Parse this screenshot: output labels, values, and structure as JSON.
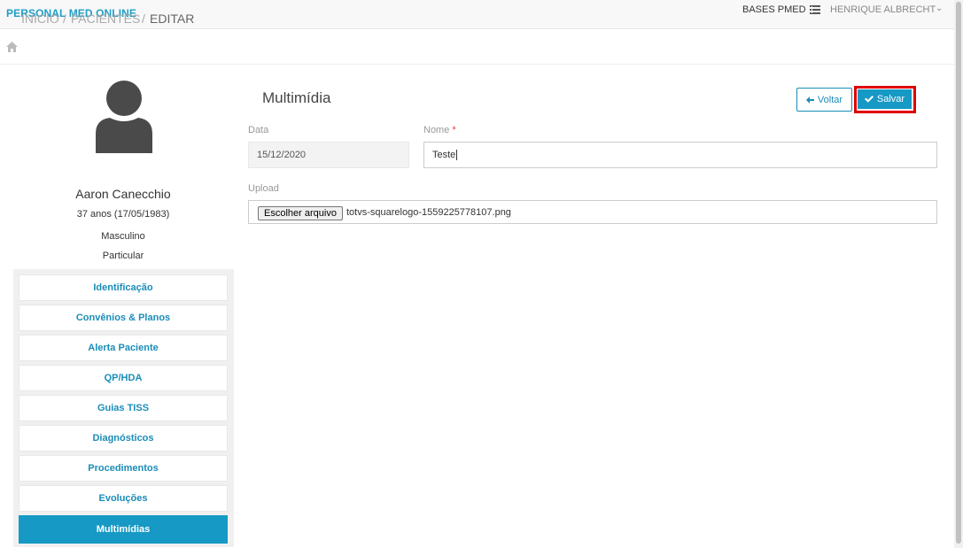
{
  "header": {
    "brand": "PERSONAL MED ONLINE",
    "bases": "BASES PMED",
    "user": "HENRIQUE ALBRECHT"
  },
  "breadcrumb": {
    "home": "INÍCIO",
    "sep1": "/",
    "patients": "PACIENTES",
    "sep2": "/",
    "current": "EDITAR"
  },
  "patient": {
    "name": "Aaron Canecchio",
    "age": "37 anos (17/05/1983)",
    "sex": "Masculino",
    "plan": "Particular"
  },
  "sidebar": {
    "items": [
      {
        "label": "Identificação"
      },
      {
        "label": "Convênios & Planos"
      },
      {
        "label": "Alerta Paciente"
      },
      {
        "label": "QP/HDA"
      },
      {
        "label": "Guias TISS"
      },
      {
        "label": "Diagnósticos"
      },
      {
        "label": "Procedimentos"
      },
      {
        "label": "Evoluções"
      },
      {
        "label": "Multimídias"
      }
    ],
    "active": "Multimídias"
  },
  "form": {
    "title": "Multimídia",
    "back_label": "Voltar",
    "save_label": "Salvar",
    "date_label": "Data",
    "date_value": "15/12/2020",
    "name_label": "Nome",
    "name_required": "*",
    "name_value": "Teste",
    "upload_label": "Upload",
    "file_button": "Escolher arquivo",
    "file_name": "totvs-squarelogo-1559225778107.png"
  },
  "colors": {
    "accent": "#1699c4",
    "highlight": "#e00000"
  }
}
